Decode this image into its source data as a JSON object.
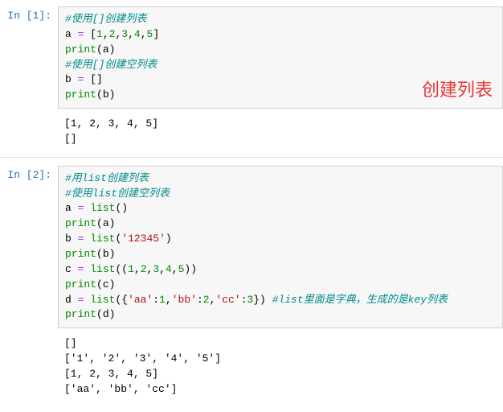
{
  "cells": [
    {
      "prompt": "In  [1]:",
      "annotation": "创建列表",
      "code": [
        [
          {
            "t": "#使用[]创建列表",
            "c": "cm"
          }
        ],
        [
          {
            "t": "a",
            "c": "var"
          },
          {
            "t": " ",
            "c": "pun"
          },
          {
            "t": "=",
            "c": "op"
          },
          {
            "t": " [",
            "c": "pun"
          },
          {
            "t": "1",
            "c": "num"
          },
          {
            "t": ",",
            "c": "pun"
          },
          {
            "t": "2",
            "c": "num"
          },
          {
            "t": ",",
            "c": "pun"
          },
          {
            "t": "3",
            "c": "num"
          },
          {
            "t": ",",
            "c": "pun"
          },
          {
            "t": "4",
            "c": "num"
          },
          {
            "t": ",",
            "c": "pun"
          },
          {
            "t": "5",
            "c": "num"
          },
          {
            "t": "]",
            "c": "pun"
          }
        ],
        [
          {
            "t": "print",
            "c": "fn"
          },
          {
            "t": "(a)",
            "c": "pun"
          }
        ],
        [
          {
            "t": "#使用[]创建空列表",
            "c": "cm"
          }
        ],
        [
          {
            "t": "b",
            "c": "var"
          },
          {
            "t": " ",
            "c": "pun"
          },
          {
            "t": "=",
            "c": "op"
          },
          {
            "t": " []",
            "c": "pun"
          }
        ],
        [
          {
            "t": "print",
            "c": "fn"
          },
          {
            "t": "(b)",
            "c": "pun"
          }
        ]
      ],
      "output": "[1, 2, 3, 4, 5]\n[]"
    },
    {
      "prompt": "In  [2]:",
      "annotation": "",
      "code": [
        [
          {
            "t": "#用list创建列表",
            "c": "cm"
          }
        ],
        [
          {
            "t": "#使用list创建空列表",
            "c": "cm"
          }
        ],
        [
          {
            "t": "a",
            "c": "var"
          },
          {
            "t": " ",
            "c": "pun"
          },
          {
            "t": "=",
            "c": "op"
          },
          {
            "t": " ",
            "c": "pun"
          },
          {
            "t": "list",
            "c": "fn"
          },
          {
            "t": "()",
            "c": "pun"
          }
        ],
        [
          {
            "t": "print",
            "c": "fn"
          },
          {
            "t": "(a)",
            "c": "pun"
          }
        ],
        [
          {
            "t": "b",
            "c": "var"
          },
          {
            "t": " ",
            "c": "pun"
          },
          {
            "t": "=",
            "c": "op"
          },
          {
            "t": " ",
            "c": "pun"
          },
          {
            "t": "list",
            "c": "fn"
          },
          {
            "t": "(",
            "c": "pun"
          },
          {
            "t": "'12345'",
            "c": "str"
          },
          {
            "t": ")",
            "c": "pun"
          }
        ],
        [
          {
            "t": "print",
            "c": "fn"
          },
          {
            "t": "(b)",
            "c": "pun"
          }
        ],
        [
          {
            "t": "c",
            "c": "var"
          },
          {
            "t": " ",
            "c": "pun"
          },
          {
            "t": "=",
            "c": "op"
          },
          {
            "t": " ",
            "c": "pun"
          },
          {
            "t": "list",
            "c": "fn"
          },
          {
            "t": "((",
            "c": "pun"
          },
          {
            "t": "1",
            "c": "num"
          },
          {
            "t": ",",
            "c": "pun"
          },
          {
            "t": "2",
            "c": "num"
          },
          {
            "t": ",",
            "c": "pun"
          },
          {
            "t": "3",
            "c": "num"
          },
          {
            "t": ",",
            "c": "pun"
          },
          {
            "t": "4",
            "c": "num"
          },
          {
            "t": ",",
            "c": "pun"
          },
          {
            "t": "5",
            "c": "num"
          },
          {
            "t": "))",
            "c": "pun"
          }
        ],
        [
          {
            "t": "print",
            "c": "fn"
          },
          {
            "t": "(c)",
            "c": "pun"
          }
        ],
        [
          {
            "t": "d",
            "c": "var"
          },
          {
            "t": " ",
            "c": "pun"
          },
          {
            "t": "=",
            "c": "op"
          },
          {
            "t": " ",
            "c": "pun"
          },
          {
            "t": "list",
            "c": "fn"
          },
          {
            "t": "({",
            "c": "pun"
          },
          {
            "t": "'aa'",
            "c": "str"
          },
          {
            "t": ":",
            "c": "pun"
          },
          {
            "t": "1",
            "c": "num"
          },
          {
            "t": ",",
            "c": "pun"
          },
          {
            "t": "'bb'",
            "c": "str"
          },
          {
            "t": ":",
            "c": "pun"
          },
          {
            "t": "2",
            "c": "num"
          },
          {
            "t": ",",
            "c": "pun"
          },
          {
            "t": "'cc'",
            "c": "str"
          },
          {
            "t": ":",
            "c": "pun"
          },
          {
            "t": "3",
            "c": "num"
          },
          {
            "t": "}) ",
            "c": "pun"
          },
          {
            "t": "#list里面是字典，生成的是key列表",
            "c": "cm"
          }
        ],
        [
          {
            "t": "print",
            "c": "fn"
          },
          {
            "t": "(d)",
            "c": "pun"
          }
        ]
      ],
      "output": "[]\n['1', '2', '3', '4', '5']\n[1, 2, 3, 4, 5]\n['aa', 'bb', 'cc']"
    }
  ]
}
